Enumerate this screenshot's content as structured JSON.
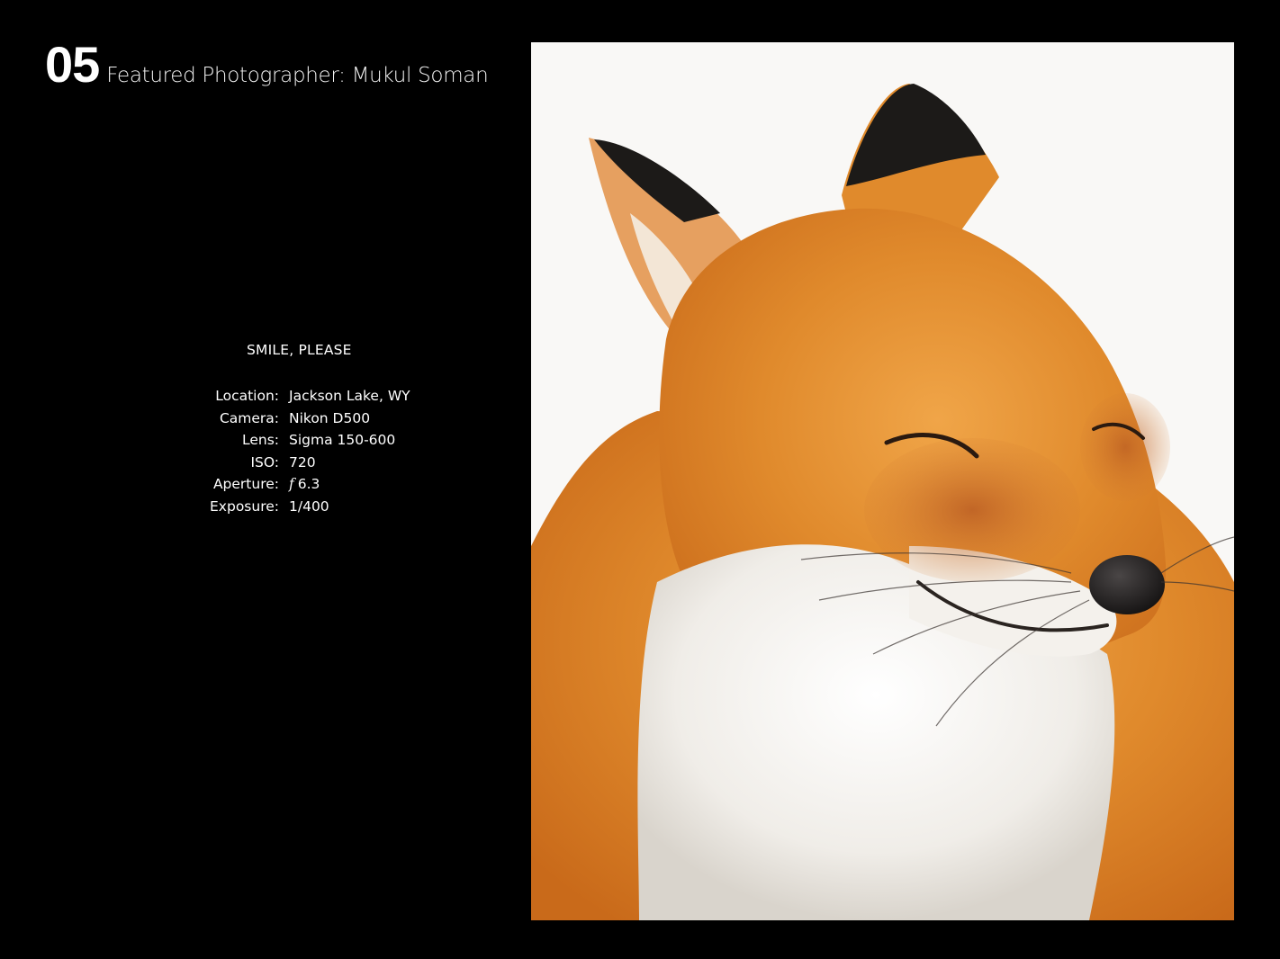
{
  "header": {
    "page_number": "05",
    "title": "Featured Photographer: Mukul Soman"
  },
  "photo": {
    "title": "SMILE, PLEASE",
    "specs": [
      {
        "label": "Location:",
        "value": "Jackson Lake, WY"
      },
      {
        "label": "Camera:",
        "value": "Nikon D500"
      },
      {
        "label": "Lens:",
        "value": "Sigma 150-600"
      },
      {
        "label": "ISO:",
        "value": "720"
      },
      {
        "label": "Aperture:",
        "value": "6.3",
        "prefix": "f"
      },
      {
        "label": "Exposure:",
        "value": "1/400"
      }
    ],
    "colors": {
      "background": "#000000",
      "fur_orange": "#e08a2c",
      "fur_white": "#f2efeb",
      "snow": "#f9f8f6",
      "ear_black": "#1c1a18"
    }
  }
}
